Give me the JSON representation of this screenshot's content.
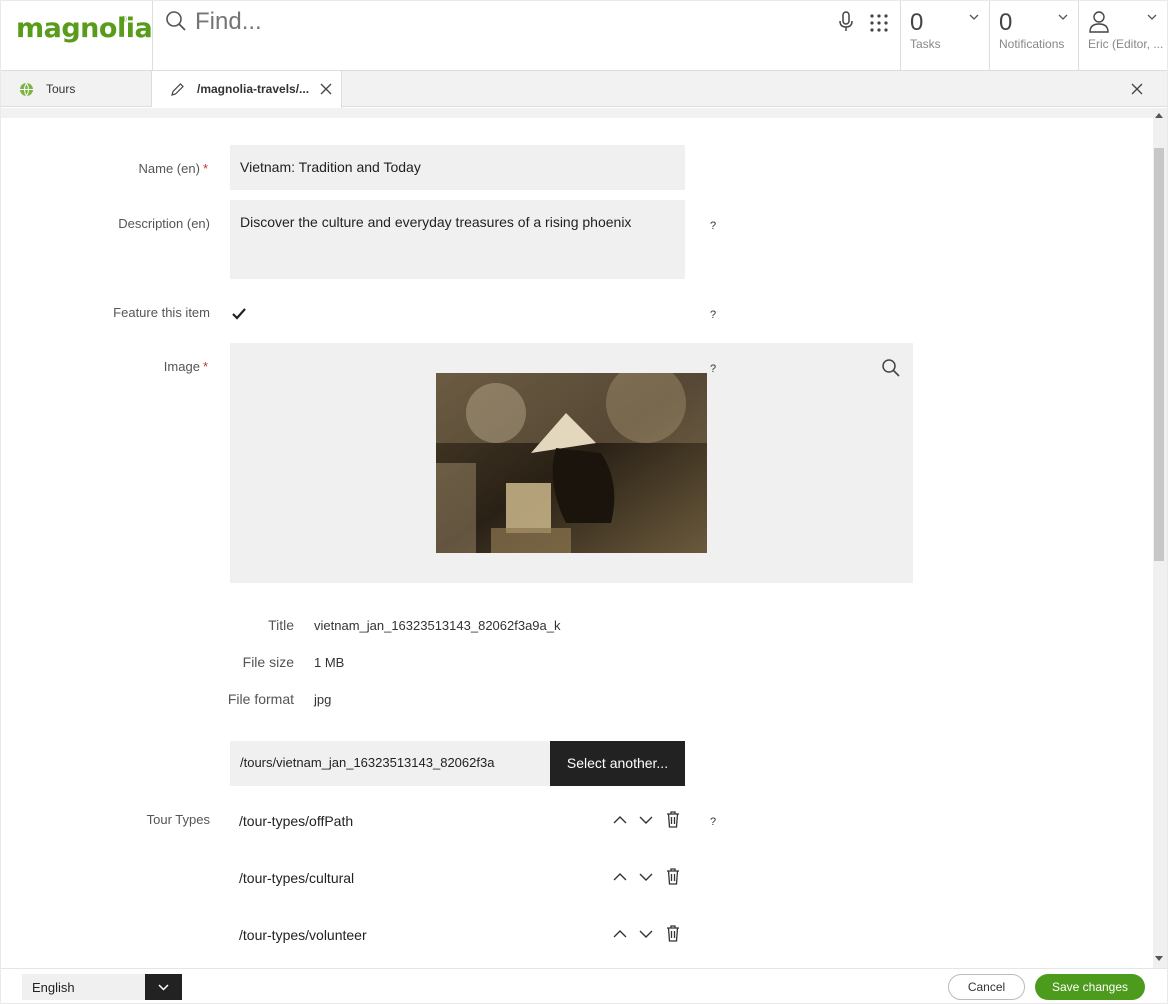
{
  "header": {
    "logo_text": "magnolia",
    "logo_mark": "®",
    "search_placeholder": "Find...",
    "tasks": {
      "count": "0",
      "label": "Tasks"
    },
    "notifications": {
      "count": "0",
      "label": "Notifications"
    },
    "user": {
      "label": "Eric (Editor, ..."
    }
  },
  "tabs": [
    {
      "label": "Tours",
      "icon": "globe-icon"
    },
    {
      "label": "/magnolia-travels/...",
      "icon": "pencil-icon"
    }
  ],
  "form": {
    "name_label": "Name (en)",
    "name_value": "Vietnam: Tradition and Today",
    "description_label": "Description (en)",
    "description_value": "Discover the culture and everyday treasures of a rising phoenix",
    "feature_label": "Feature this item",
    "feature_checked": true,
    "image_label": "Image",
    "required_mark": "*",
    "help_mark": "?",
    "image_meta": {
      "title_label": "Title",
      "title_value": "vietnam_jan_16323513143_82062f3a9a_k",
      "filesize_label": "File size",
      "filesize_value": "1 MB",
      "format_label": "File format",
      "format_value": "jpg"
    },
    "image_path": "/tours/vietnam_jan_16323513143_82062f3a",
    "select_another_label": "Select another...",
    "tour_types_label": "Tour Types",
    "tour_types": [
      "/tour-types/offPath",
      "/tour-types/cultural",
      "/tour-types/volunteer"
    ]
  },
  "footer": {
    "language": "English",
    "cancel_label": "Cancel",
    "save_label": "Save changes"
  },
  "colors": {
    "brand": "#599b1a",
    "save": "#4c9b1c",
    "required": "#c0392b",
    "field_bg": "#f0f0f0"
  }
}
